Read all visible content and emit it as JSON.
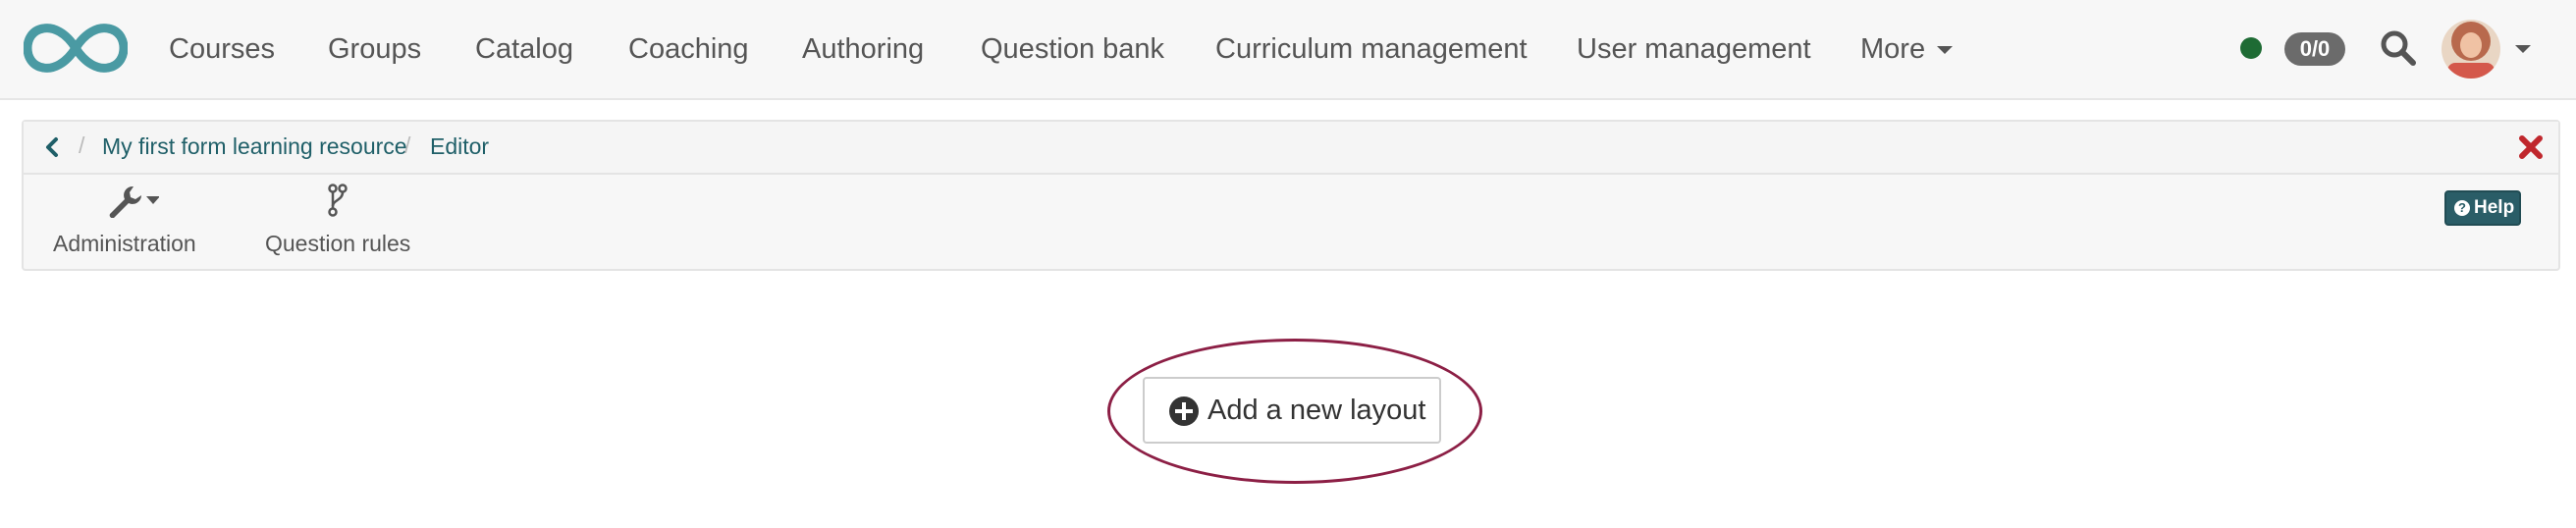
{
  "nav": {
    "logo_icon": "infinity-logo-icon",
    "items": [
      "Courses",
      "Groups",
      "Catalog",
      "Coaching",
      "Authoring",
      "Question bank",
      "Curriculum management",
      "User management"
    ],
    "more_label": "More",
    "badge": "0/0",
    "status_color": "#1e6b34",
    "brand_color": "#4a9aa3"
  },
  "breadcrumb": {
    "resource": "My first form learning resource",
    "current": "Editor"
  },
  "toolbar": {
    "administration": "Administration",
    "question_rules": "Question rules",
    "help": "Help"
  },
  "main": {
    "add_layout": "Add a new layout"
  },
  "colors": {
    "link": "#1f5f68",
    "close": "#c0272d",
    "highlight": "#8c1f45"
  }
}
